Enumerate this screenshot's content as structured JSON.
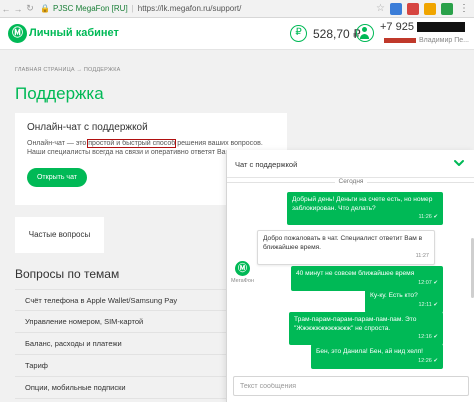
{
  "browser": {
    "back_icon": "back-arrow-icon",
    "forward_icon": "forward-arrow-icon",
    "reload_icon": "reload-icon",
    "site_identity": "PJSC MegaFon [RU]",
    "url": "https://lk.megafon.ru/support/",
    "ext_colors": [
      "#3b7dd8",
      "#d64541",
      "#f0a500",
      "#2aa14a"
    ]
  },
  "header": {
    "logo_letter": "Ⓜ",
    "logo_text": "Личный кабинет",
    "currency_symbol": "₽",
    "balance": "528,70 ₽",
    "phone": "+7 925",
    "user_name": "Владимир Пе..."
  },
  "breadcrumb": "ГЛАВНАЯ СТРАНИЦА  →  ПОДДЕРЖКА",
  "page_title": "Поддержка",
  "chat_card": {
    "title": "Онлайн-чат с поддержкой",
    "desc_before": "Онлайн-чат — это ",
    "desc_highlight": "простой и быстрый способ",
    "desc_after": " решения ваших вопросов. Наши специалисты всегда на связи и оперативно ответят Вам",
    "button": "Открыть чат"
  },
  "faq_tab": "Частые вопросы",
  "topics": {
    "title": "Вопросы по темам",
    "items": [
      "Счёт телефона в Apple Wallet/Samsung Pay",
      "Управление номером, SIM-картой",
      "Баланс, расходы и платежи",
      "Тариф",
      "Опции, мобильные подписки"
    ]
  },
  "chat": {
    "title": "Чат с поддержкой",
    "date": "Сегодня",
    "bot_name": "МегаФон",
    "messages": [
      {
        "dir": "out",
        "text": "Добрый день! Деньги на счете есть, но номер заблокирован. Что делать?",
        "time": "11:26",
        "check": "✔"
      },
      {
        "dir": "in",
        "text": "Добро пожаловать в чат. Специалист ответит Вам в ближайшее время.",
        "time": "11:27",
        "check": ""
      },
      {
        "dir": "out",
        "text": "40 минут не совсем ближайшее время",
        "time": "12:07",
        "check": "✔"
      },
      {
        "dir": "out",
        "text": "Ку-ку. Есть кто?",
        "time": "12:11",
        "check": "✔"
      },
      {
        "dir": "out",
        "text": "Трам-парам-парам-парам-пам-пам. Это \"Жжжжжжжжжжжж\" не спроста.",
        "time": "12:16",
        "check": "✔"
      },
      {
        "dir": "out",
        "text": "Бен, это Данила! Бен, ай нид хелп!",
        "time": "12:26",
        "check": "✔"
      }
    ],
    "input_placeholder": "Текст сообщения"
  },
  "colors": {
    "brand_green": "#00b956",
    "highlight_box": "#b01010"
  }
}
